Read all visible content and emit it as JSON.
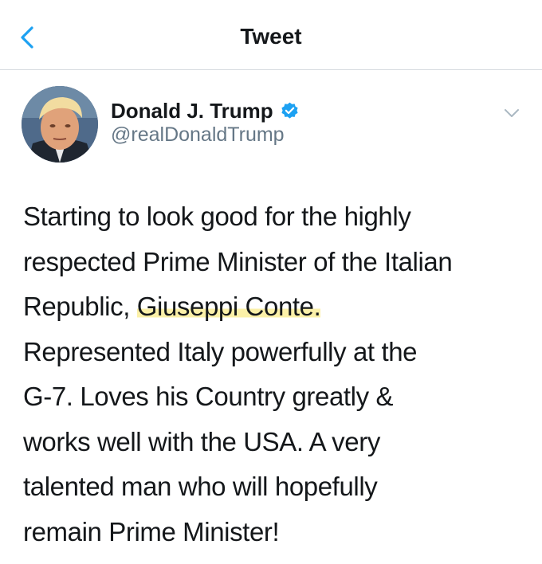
{
  "topbar": {
    "title": "Tweet",
    "back_icon": "chevron-left-icon"
  },
  "author": {
    "display_name": "Donald J. Trump",
    "handle": "@realDonaldTrump",
    "verified": true,
    "verified_icon": "verified-badge-icon",
    "avatar_icon": "profile-photo"
  },
  "menu": {
    "icon": "chevron-down-icon"
  },
  "tweet": {
    "lines": [
      "Starting to look good for the highly",
      "respected Prime Minister of the Italian",
      "Republic, ",
      "Represented Italy powerfully at the",
      "G-7. Loves his Country greatly &",
      "works well with the USA. A very",
      "talented man who will hopefully",
      "remain Prime Minister!"
    ],
    "highlighted_text": "Giuseppi Conte."
  },
  "colors": {
    "accent": "#1da1f2",
    "text": "#14171a",
    "secondary_text": "#657786",
    "divider": "#d6dbe0",
    "highlight": "#fbf0a8"
  }
}
